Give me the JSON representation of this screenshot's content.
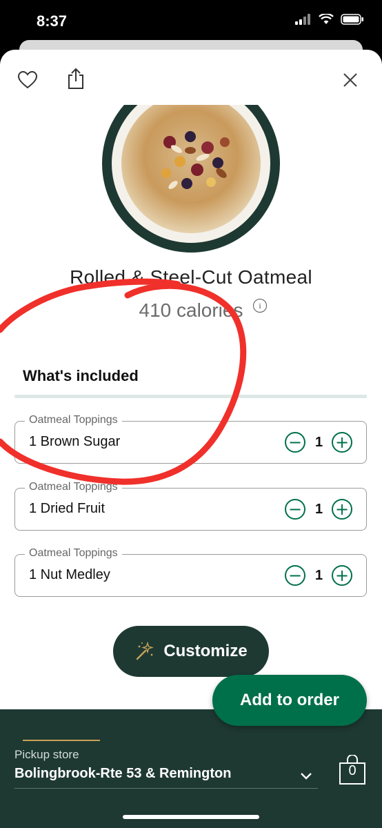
{
  "status_bar": {
    "time": "8:37"
  },
  "product": {
    "name": "Rolled & Steel-Cut Oatmeal",
    "calories": "410 calories"
  },
  "section_title": "What's included",
  "toppings": [
    {
      "legend": "Oatmeal Toppings",
      "value": "1 Brown Sugar",
      "qty": "1"
    },
    {
      "legend": "Oatmeal Toppings",
      "value": "1 Dried Fruit",
      "qty": "1"
    },
    {
      "legend": "Oatmeal Toppings",
      "value": "1 Nut Medley",
      "qty": "1"
    }
  ],
  "buttons": {
    "customize": "Customize",
    "add_to_order": "Add to order"
  },
  "pickup": {
    "label": "Pickup store",
    "store": "Bolingbrook-Rte 53 & Remington",
    "bag_count": "0"
  },
  "colors": {
    "brand_dark": "#1e3932",
    "brand_green": "#00704a",
    "gold": "#cba258",
    "annotation_red": "#f0302a"
  },
  "icons": [
    "heart-icon",
    "share-icon",
    "close-icon",
    "info-icon",
    "minus-icon",
    "plus-icon",
    "sparkle-wand-icon",
    "chevron-down-icon",
    "bag-icon"
  ]
}
